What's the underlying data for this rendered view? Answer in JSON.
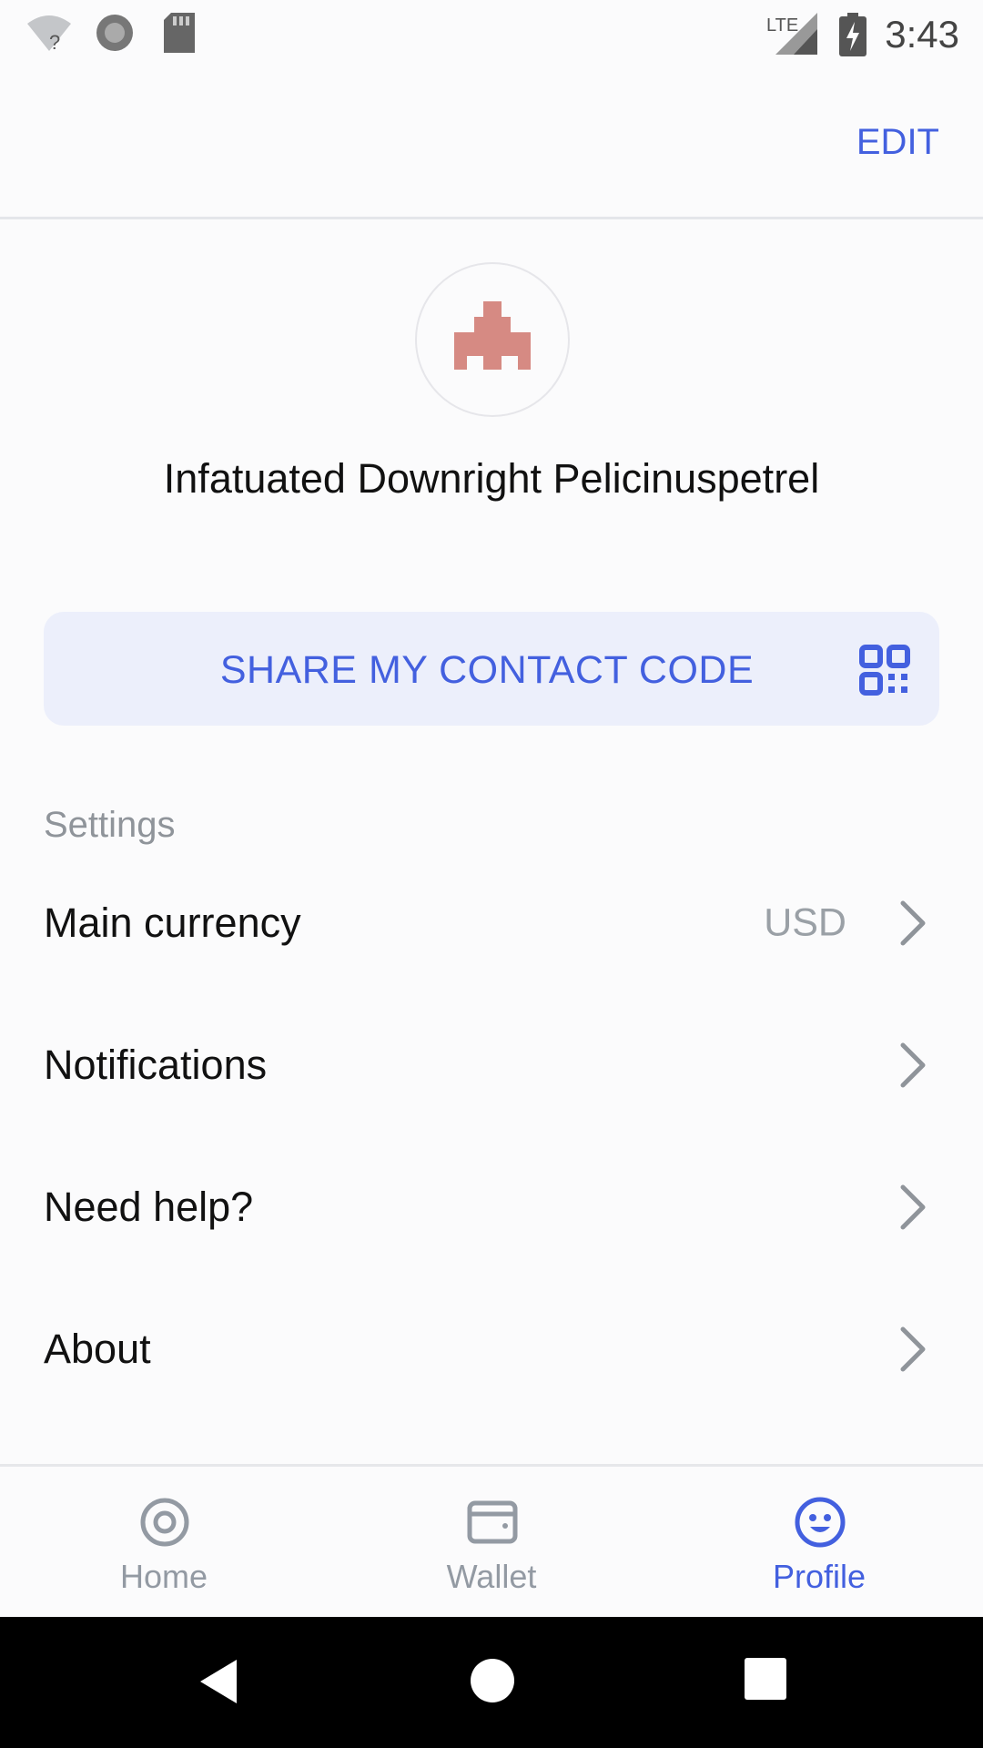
{
  "status_bar": {
    "time": "3:43",
    "network": "LTE",
    "icons": [
      "wifi-unknown-icon",
      "record-icon",
      "sd-card-icon",
      "lte-signal-icon",
      "battery-charging-icon"
    ]
  },
  "header": {
    "edit_label": "EDIT"
  },
  "profile": {
    "display_name": "Infatuated Downright Pelicinuspetrel",
    "avatar_icon": "identicon-avatar",
    "avatar_color": "#d68a83"
  },
  "share_button": {
    "label": "SHARE MY CONTACT CODE",
    "icon": "qr-code-icon"
  },
  "settings": {
    "title": "Settings",
    "items": [
      {
        "label": "Main currency",
        "value": "USD"
      },
      {
        "label": "Notifications",
        "value": ""
      },
      {
        "label": "Need help?",
        "value": ""
      },
      {
        "label": "About",
        "value": ""
      }
    ]
  },
  "bottom_nav": {
    "items": [
      {
        "label": "Home",
        "icon": "home-icon",
        "active": false
      },
      {
        "label": "Wallet",
        "icon": "wallet-icon",
        "active": false
      },
      {
        "label": "Profile",
        "icon": "profile-smiley-icon",
        "active": true
      }
    ]
  },
  "colors": {
    "accent": "#4360df",
    "muted": "#939aa3",
    "share_bg": "#eceffb"
  }
}
